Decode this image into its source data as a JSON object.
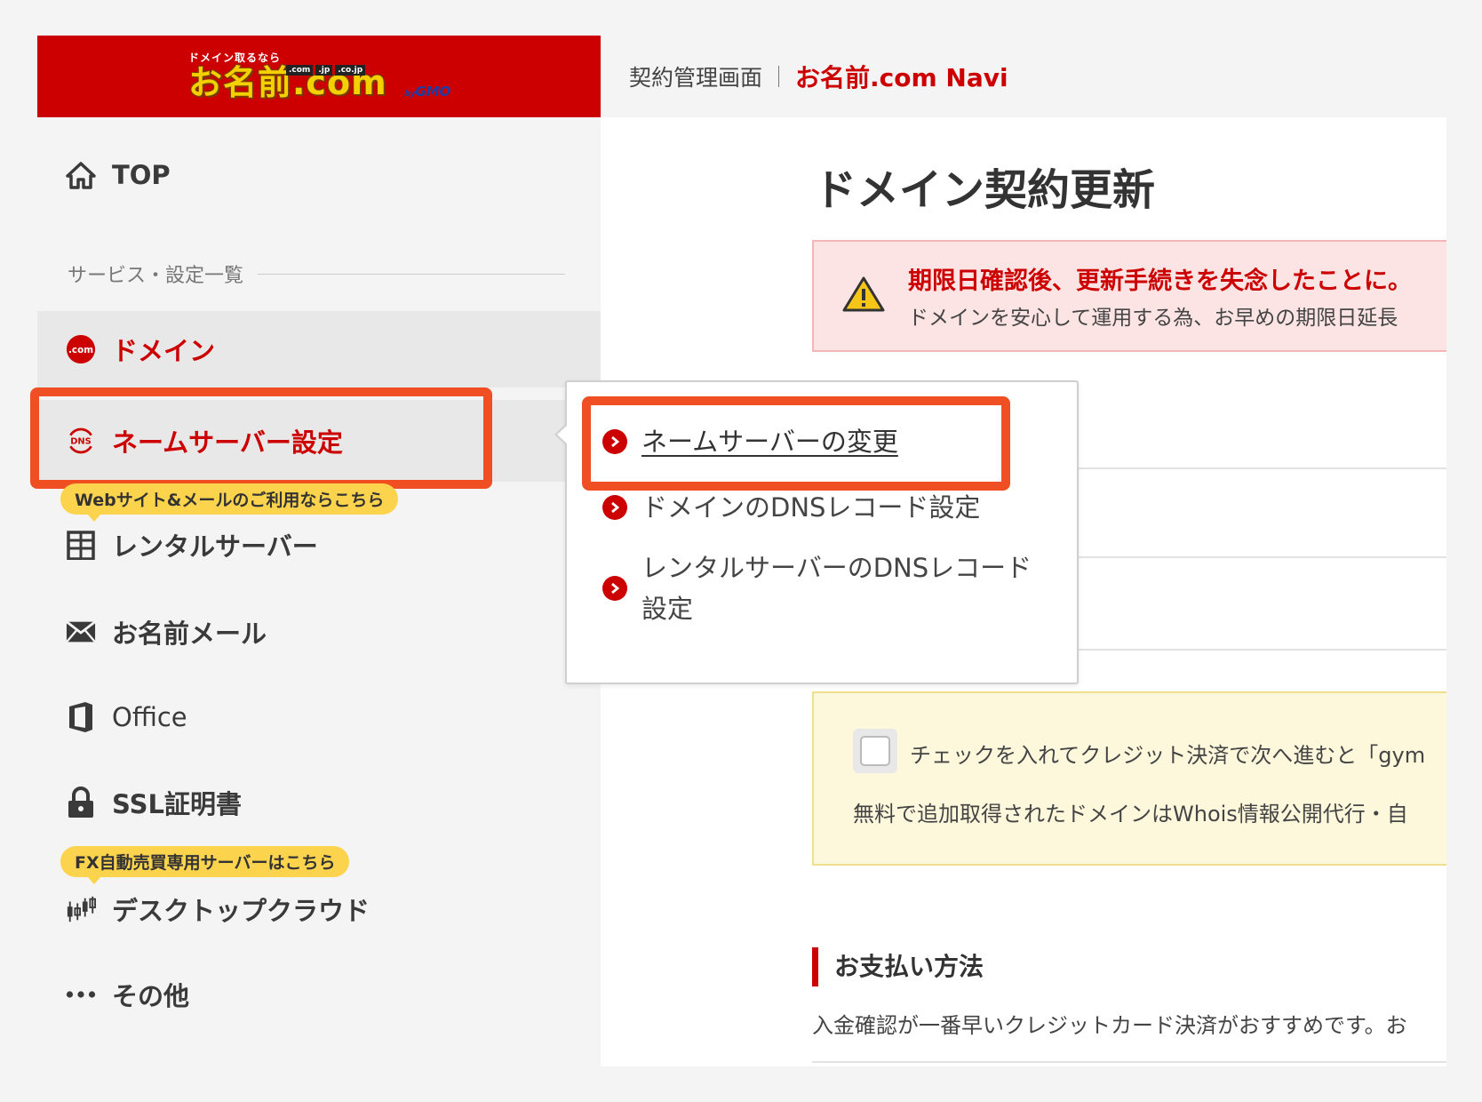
{
  "colors": {
    "brand_red": "#cc0000",
    "highlight_orange": "#f04e23",
    "badge_yellow": "#fcd34d"
  },
  "logo": {
    "tagline": "ドメイン取るなら",
    "tlds": [
      ".com",
      ".jp",
      ".co.jp"
    ],
    "name": "お名前.com",
    "by": "by",
    "company": "GMO"
  },
  "header": {
    "label": "契約管理画面",
    "brand": "お名前.com Navi"
  },
  "sidebar": {
    "top": {
      "label": "TOP",
      "icon": "home-icon"
    },
    "section_title": "サービス・設定一覧",
    "items": [
      {
        "label": "ドメイン",
        "icon": "dotcom-icon",
        "icon_text": ".com"
      },
      {
        "label": "ネームサーバー設定",
        "icon": "dns-icon",
        "icon_text": "DNS"
      },
      {
        "label": "レンタルサーバー",
        "icon": "server-icon",
        "badge": "Webサイト&メールのご利用ならこちら"
      },
      {
        "label": "お名前メール",
        "icon": "mail-icon"
      },
      {
        "label": "Office",
        "icon": "office-icon"
      },
      {
        "label": "SSL証明書",
        "icon": "lock-icon"
      },
      {
        "label": "デスクトップクラウド",
        "icon": "chart-icon",
        "badge": "FX自動売買専用サーバーはこちら"
      },
      {
        "label": "その他",
        "icon": "more-icon"
      }
    ]
  },
  "dropdown": {
    "items": [
      {
        "label": "ネームサーバーの変更"
      },
      {
        "label": "ドメインのDNSレコード設定"
      },
      {
        "label_line1": "レンタルサーバーのDNSレコード",
        "label_line2": "設定"
      }
    ]
  },
  "main": {
    "title": "ドメイン契約更新",
    "alert": {
      "title": "期限日確認後、更新手続きを失念したことに。",
      "text": "ドメインを安心して運用する為、お早めの期限日延長"
    },
    "notice": {
      "line1": "チェックを入れてクレジット決済で次へ進むと「gym",
      "line2": "無料で追加取得されたドメインはWhois情報公開代行・自"
    },
    "payment": {
      "heading": "お支払い方法",
      "text": "入金確認が一番早いクレジットカード決済がおすすめです。お"
    }
  }
}
